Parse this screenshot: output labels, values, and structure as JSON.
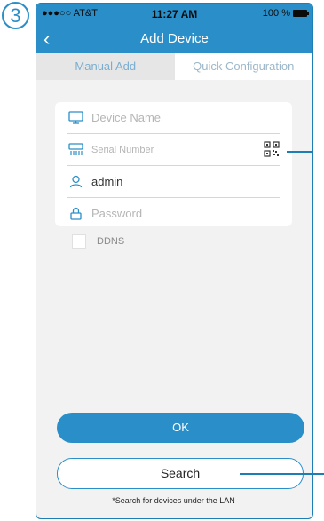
{
  "annotation": {
    "step_number": "3"
  },
  "status_bar": {
    "carrier": "●●●○○ AT&T",
    "time": "11:27 AM",
    "battery": "100 %"
  },
  "nav": {
    "title": "Add Device",
    "back_icon": "chevron-left-icon"
  },
  "tabs": [
    {
      "label": "Manual Add",
      "active": true
    },
    {
      "label": "Quick Configuration",
      "active": false
    }
  ],
  "form": {
    "device_name": {
      "placeholder": "Device Name",
      "value": ""
    },
    "serial_number": {
      "placeholder": "Serial Number",
      "value": ""
    },
    "username": {
      "placeholder": "",
      "value": "admin"
    },
    "password": {
      "placeholder": "Password",
      "value": ""
    }
  },
  "ddns": {
    "label": "DDNS",
    "checked": false
  },
  "buttons": {
    "ok": "OK",
    "search": "Search"
  },
  "hint": "*Search for devices under the LAN",
  "colors": {
    "accent": "#2a8fc8",
    "background": "#f2f2f2"
  }
}
